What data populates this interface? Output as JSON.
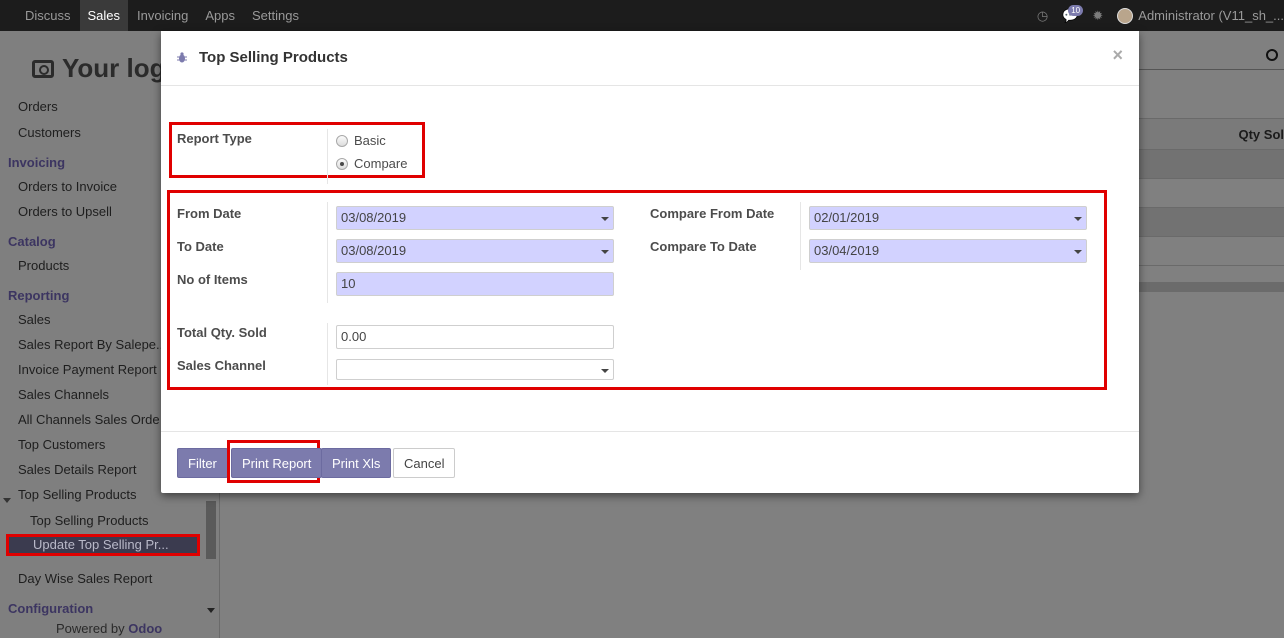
{
  "navbar": {
    "items": [
      "Discuss",
      "Sales",
      "Invoicing",
      "Apps",
      "Settings"
    ],
    "active": "Sales",
    "message_count": "10",
    "user": "Administrator (V11_sh_..."
  },
  "sidebar": {
    "logo_text": "Your log",
    "orders": "Orders",
    "customers": "Customers",
    "invoicing": "Invoicing",
    "orders_to_invoice": "Orders to Invoice",
    "orders_to_upsell": "Orders to Upsell",
    "catalog": "Catalog",
    "products": "Products",
    "reporting": "Reporting",
    "sales": "Sales",
    "sales_report_by_salesperson": "Sales Report By Salepe...",
    "invoice_payment_report": "Invoice Payment Report",
    "sales_channels": "Sales Channels",
    "all_channels_sales_orders": "All Channels Sales Orde",
    "top_customers": "Top Customers",
    "sales_details_report": "Sales Details Report",
    "top_selling_products": "Top Selling Products",
    "top_selling_products_sub": "Top Selling Products",
    "update_top_selling": "Update Top Selling Pr...",
    "day_wise_sales_report": "Day Wise Sales Report",
    "configuration": "Configuration",
    "powered_by": "Powered by ",
    "odoo": "Odoo"
  },
  "background": {
    "column_header": "Qty Sol"
  },
  "modal": {
    "title": "Top Selling Products",
    "close": "×",
    "report_type_label": "Report Type",
    "radio_basic": "Basic",
    "radio_compare": "Compare",
    "report_type_selected": "Compare",
    "from_date_label": "From Date",
    "from_date": "03/08/2019",
    "to_date_label": "To Date",
    "to_date": "03/08/2019",
    "no_of_items_label": "No of Items",
    "no_of_items": "10",
    "compare_from_date_label": "Compare From Date",
    "compare_from_date": "02/01/2019",
    "compare_to_date_label": "Compare To Date",
    "compare_to_date": "03/04/2019",
    "total_qty_label": "Total Qty. Sold",
    "total_qty": "0.00",
    "sales_channel_label": "Sales Channel",
    "sales_channel": ""
  },
  "buttons": {
    "filter": "Filter",
    "print_report": "Print Report",
    "print_xls": "Print Xls",
    "cancel": "Cancel"
  },
  "colors": {
    "primary": "#7c7bad",
    "highlight_border": "#e00000",
    "required_field": "#d2d2ff"
  }
}
